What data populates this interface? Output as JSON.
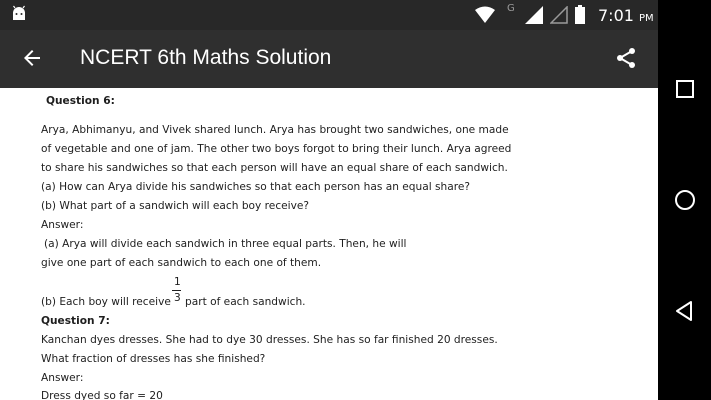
{
  "status_bar": {
    "network_label": "G",
    "time": "7:01",
    "time_suffix": "PM"
  },
  "app_bar": {
    "title": "NCERT 6th Maths Solution"
  },
  "content": {
    "q6_heading": "Question 6:",
    "q6_text": [
      "Arya, Abhimanyu, and Vivek shared lunch. Arya has brought two sandwiches, one made",
      "of vegetable and one of jam. The other two boys forgot to bring their lunch. Arya agreed",
      "to share his sandwiches so that each person will have an equal share of each sandwich.",
      "(a) How can Arya divide his sandwiches so that each person has an equal share?",
      "(b) What part of a sandwich will each boy receive?"
    ],
    "answer_label_1": "Answer:",
    "q6_answer_a": [
      "(a) Arya will divide each sandwich in three equal parts. Then, he will",
      "give one part of each sandwich to each one of them."
    ],
    "q6_answer_b_prefix": "(b) Each boy will receive",
    "fraction_numerator": "1",
    "fraction_denominator": "3",
    "q6_answer_b_suffix": "part of each sandwich.",
    "q7_heading": "Question 7:",
    "q7_text": [
      "Kanchan dyes dresses. She had to dye 30 dresses. She has so far finished 20 dresses.",
      "What fraction of dresses has she finished?"
    ],
    "answer_label_2": "Answer:",
    "q7_answer_line": "Dress dyed so far = 20"
  },
  "icons": {
    "status": [
      "android-icon",
      "wifi-icon",
      "signal-icon",
      "signal-empty-icon",
      "battery-icon"
    ],
    "app_bar": [
      "back-arrow-icon",
      "share-icon"
    ],
    "nav": [
      "recents-square-icon",
      "home-circle-icon",
      "back-triangle-icon"
    ]
  },
  "colors": {
    "status_bar_bg": "#282828",
    "app_bar_bg": "#2f2f2f",
    "nav_bar_bg": "#000000",
    "content_text": "#1e1e1e"
  }
}
